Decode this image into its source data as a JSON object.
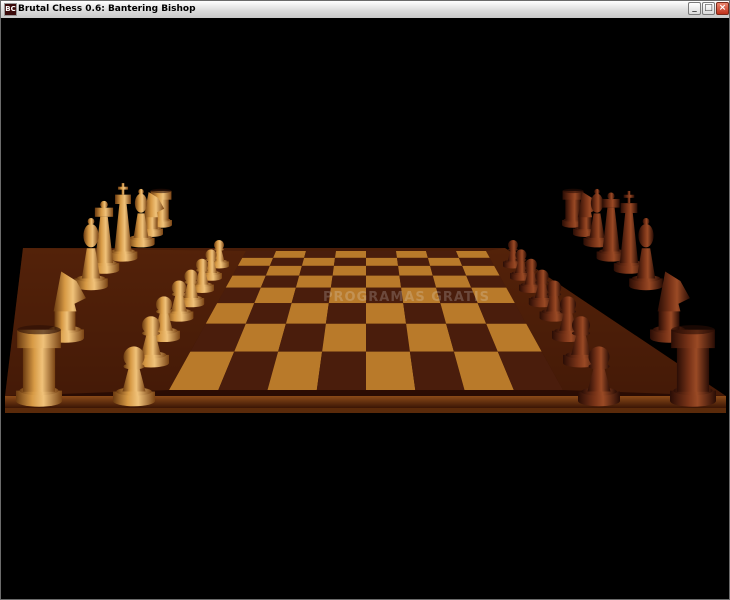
{
  "window": {
    "title": "Brutal Chess 0.6: Bantering Bishop",
    "icon": "brutal-chess-app-icon",
    "controls": [
      "minimize-icon",
      "maximize-icon",
      "close-icon"
    ]
  },
  "scene": {
    "background_color": "#000000",
    "light_square_color": "#b97a2a",
    "dark_square_color": "#4a1d0c",
    "light_piece_color": "#c98a3a",
    "dark_piece_color": "#6b2c14",
    "white_pieces": [
      "rook",
      "knight",
      "bishop",
      "queen",
      "king",
      "bishop",
      "knight",
      "rook",
      "pawn",
      "pawn",
      "pawn",
      "pawn",
      "pawn",
      "pawn",
      "pawn",
      "pawn"
    ],
    "black_pieces": [
      "rook",
      "knight",
      "bishop",
      "queen",
      "king",
      "bishop",
      "knight",
      "rook",
      "pawn",
      "pawn",
      "pawn",
      "pawn",
      "pawn",
      "pawn",
      "pawn",
      "pawn"
    ]
  },
  "watermark": "PROGRAMAS GRATIS"
}
